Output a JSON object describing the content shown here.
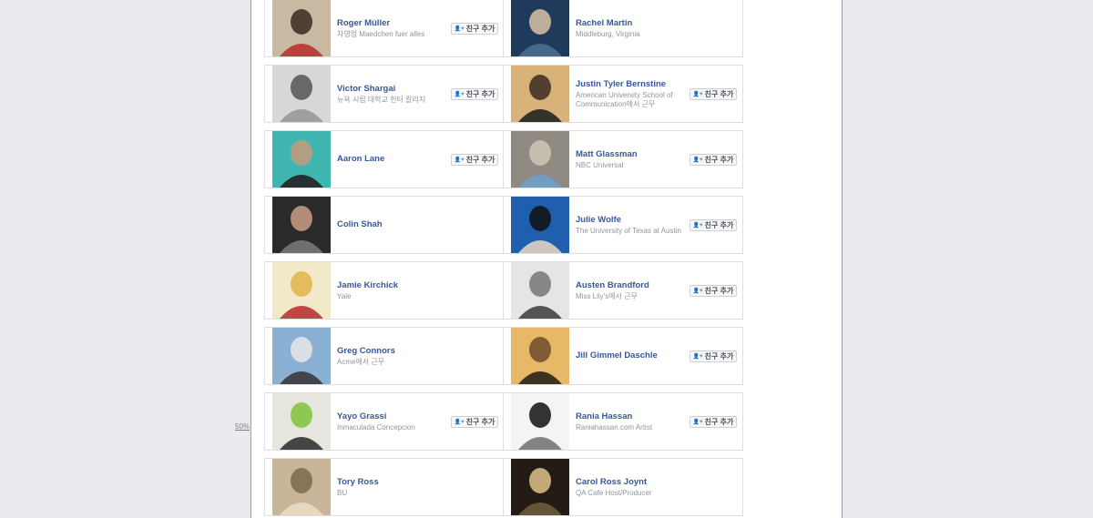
{
  "zoom_label": "50%",
  "button_label": "친구 추가",
  "button_icon": "add-friend-icon",
  "cards": [
    {
      "name": "Roger Müller",
      "sub": "자영업 Maedchen fuer alles",
      "button": true,
      "photo": "man-in-red-suit",
      "colors": [
        "#c9b9a3",
        "#3a2a22",
        "#b33"
      ]
    },
    {
      "name": "Rachel Martin",
      "sub": "Middleburg, Virginia",
      "button": false,
      "photo": "woman-blue-sky",
      "colors": [
        "#1f3a5a",
        "#d9c3a4",
        "#4a6f8e"
      ]
    },
    {
      "name": "Victor Shargai",
      "sub": "뉴욕 시립 대학교 헌터 칼리지",
      "button": true,
      "photo": "bw-laughing-man",
      "colors": [
        "#d8d8d8",
        "#555",
        "#999"
      ]
    },
    {
      "name": "Justin Tyler Bernstine",
      "sub": "American University School of Communication에서 근무",
      "button": true,
      "photo": "man-in-suit",
      "colors": [
        "#d9b27a",
        "#3b2a21",
        "#222"
      ]
    },
    {
      "name": "Aaron Lane",
      "sub": "",
      "button": true,
      "photo": "man-sunglasses-pool",
      "colors": [
        "#3fb6b0",
        "#c79a7a",
        "#222"
      ]
    },
    {
      "name": "Matt Glassman",
      "sub": "NBC Universal",
      "button": true,
      "photo": "man-on-beach",
      "colors": [
        "#8e8a82",
        "#cfc6b6",
        "#6fa0c9"
      ]
    },
    {
      "name": "Colin Shah",
      "sub": "",
      "button": false,
      "photo": "man-phone-bw",
      "colors": [
        "#2a2a2a",
        "#c99e85",
        "#777"
      ]
    },
    {
      "name": "Julie Wolfe",
      "sub": "The University of Texas at Austin",
      "button": true,
      "photo": "woman-silhouette-blue",
      "colors": [
        "#1f5fae",
        "#111",
        "#e0d1c5"
      ]
    },
    {
      "name": "Jamie Kirchick",
      "sub": "Yale",
      "button": false,
      "photo": "cartoon-drawing",
      "colors": [
        "#f1e9c8",
        "#e3b44a",
        "#b33"
      ]
    },
    {
      "name": "Austen Brandford",
      "sub": "Miss Lily's에서 근무",
      "button": true,
      "photo": "group-bw",
      "colors": [
        "#e5e5e5",
        "#777",
        "#444"
      ]
    },
    {
      "name": "Greg Connors",
      "sub": "Acme에서 근무",
      "button": false,
      "photo": "man-mountains",
      "colors": [
        "#8ab0d4",
        "#e7e7e7",
        "#3a3a3a"
      ]
    },
    {
      "name": "Jill Gimmel Daschle",
      "sub": "",
      "button": true,
      "photo": "sunset",
      "colors": [
        "#e7b865",
        "#6d4a2a",
        "#2d2418"
      ]
    },
    {
      "name": "Yayo Grassi",
      "sub": "Inmaculada Concepcion",
      "button": true,
      "photo": "man-white-shirt",
      "colors": [
        "#e6e6df",
        "#7ec23a",
        "#333"
      ]
    },
    {
      "name": "Rania Hassan",
      "sub": "Raniahassan.com Artist",
      "button": true,
      "photo": "bw-cat-art",
      "colors": [
        "#f4f4f4",
        "#111",
        "#777"
      ]
    },
    {
      "name": "Tory Ross",
      "sub": "BU",
      "button": false,
      "photo": "woman-outdoor",
      "colors": [
        "#c8b59a",
        "#7a6a4e",
        "#e9dcc4"
      ]
    },
    {
      "name": "Carol Ross Joynt",
      "sub": "QA Cafe Host/Producer",
      "button": false,
      "photo": "woman-dark-bg",
      "colors": [
        "#221c14",
        "#e0c18a",
        "#6b5a3a"
      ]
    }
  ]
}
